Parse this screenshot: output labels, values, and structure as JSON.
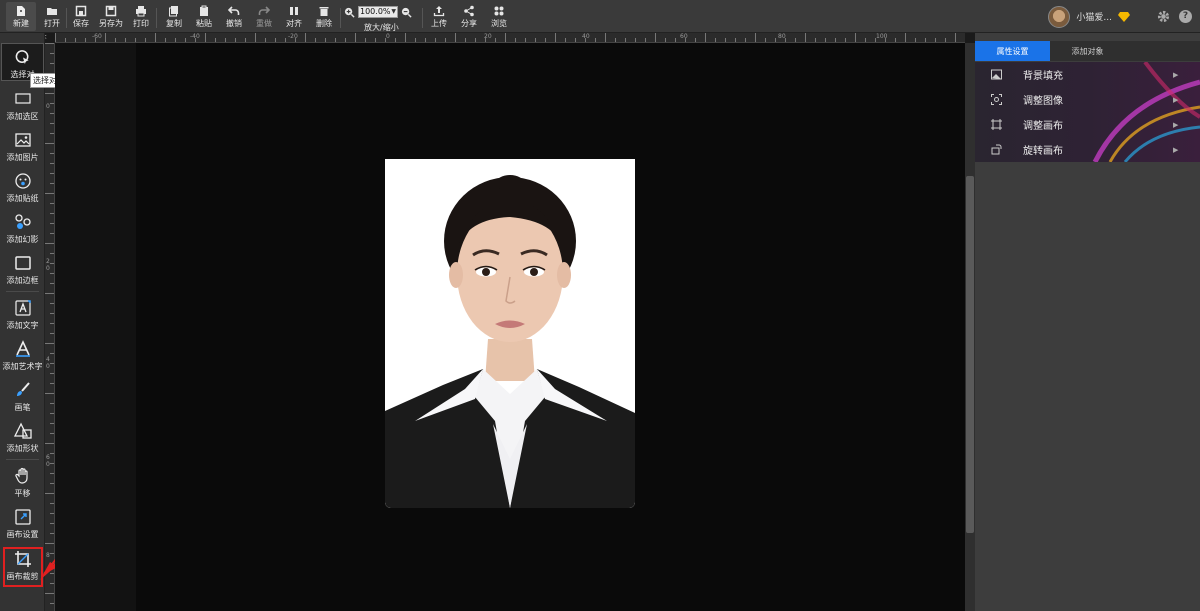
{
  "toolbar": {
    "buttons": [
      {
        "id": "new",
        "label": "新建",
        "icon": "new-file-icon"
      },
      {
        "id": "open",
        "label": "打开",
        "icon": "folder-icon"
      },
      {
        "id": "save",
        "label": "保存",
        "icon": "save-icon"
      },
      {
        "id": "saveas",
        "label": "另存为",
        "icon": "save-as-icon"
      },
      {
        "id": "print",
        "label": "打印",
        "icon": "printer-icon"
      },
      {
        "id": "copy",
        "label": "复制",
        "icon": "copy-icon"
      },
      {
        "id": "paste",
        "label": "粘贴",
        "icon": "paste-icon"
      },
      {
        "id": "undo",
        "label": "撤销",
        "icon": "undo-icon"
      },
      {
        "id": "redo",
        "label": "重做",
        "icon": "redo-icon"
      },
      {
        "id": "align",
        "label": "对齐",
        "icon": "align-icon"
      },
      {
        "id": "delete",
        "label": "删除",
        "icon": "trash-icon"
      },
      {
        "id": "upload",
        "label": "上传",
        "icon": "upload-icon"
      },
      {
        "id": "share",
        "label": "分享",
        "icon": "share-icon"
      },
      {
        "id": "browse",
        "label": "浏览",
        "icon": "grid-icon"
      }
    ],
    "zoom": {
      "value": "100.0%",
      "label": "放大/缩小"
    },
    "user_name": "小猫爱...",
    "help": "?"
  },
  "rulers": {
    "collapse_left": "< <",
    "collapse_right": "> >",
    "top_labels": [
      "-60",
      "-40",
      "-20",
      "0",
      "20",
      "40",
      "60",
      "80",
      "100"
    ],
    "left_labels": [
      "0",
      "2",
      "0",
      "4",
      "0",
      "6",
      "0",
      "8"
    ]
  },
  "sidebar": {
    "tooltip": "选择对象",
    "items": [
      {
        "label": "选择对",
        "icon": "select-cursor-icon"
      },
      {
        "label": "添加选区",
        "icon": "selection-rect-icon"
      },
      {
        "label": "添加图片",
        "icon": "image-icon"
      },
      {
        "label": "添加贴纸",
        "icon": "sticker-icon"
      },
      {
        "label": "添加幻影",
        "icon": "phantom-icon"
      },
      {
        "label": "添加边框",
        "icon": "border-frame-icon"
      },
      {
        "label": "添加文字",
        "icon": "text-icon"
      },
      {
        "label": "添加艺术字",
        "icon": "art-text-icon"
      },
      {
        "label": "画笔",
        "icon": "brush-icon"
      },
      {
        "label": "添加形状",
        "icon": "shapes-icon"
      },
      {
        "label": "平移",
        "icon": "hand-icon"
      },
      {
        "label": "画布设置",
        "icon": "canvas-settings-icon"
      },
      {
        "label": "画布裁剪",
        "icon": "crop-icon"
      }
    ]
  },
  "right_panel": {
    "tabs": [
      {
        "label": "属性设置",
        "active": true
      },
      {
        "label": "添加对象",
        "active": false
      }
    ],
    "menu": [
      {
        "label": "背景填充",
        "icon": "background-fill-icon"
      },
      {
        "label": "调整图像",
        "icon": "adjust-image-icon"
      },
      {
        "label": "调整画布",
        "icon": "adjust-canvas-icon"
      },
      {
        "label": "旋转画布",
        "icon": "rotate-canvas-icon"
      }
    ]
  },
  "colors": {
    "accent": "#1a73e8",
    "highlight": "#e02020",
    "toolbar_bg": "#3a3a3a",
    "canvas_bg": "#0a0a0a"
  }
}
